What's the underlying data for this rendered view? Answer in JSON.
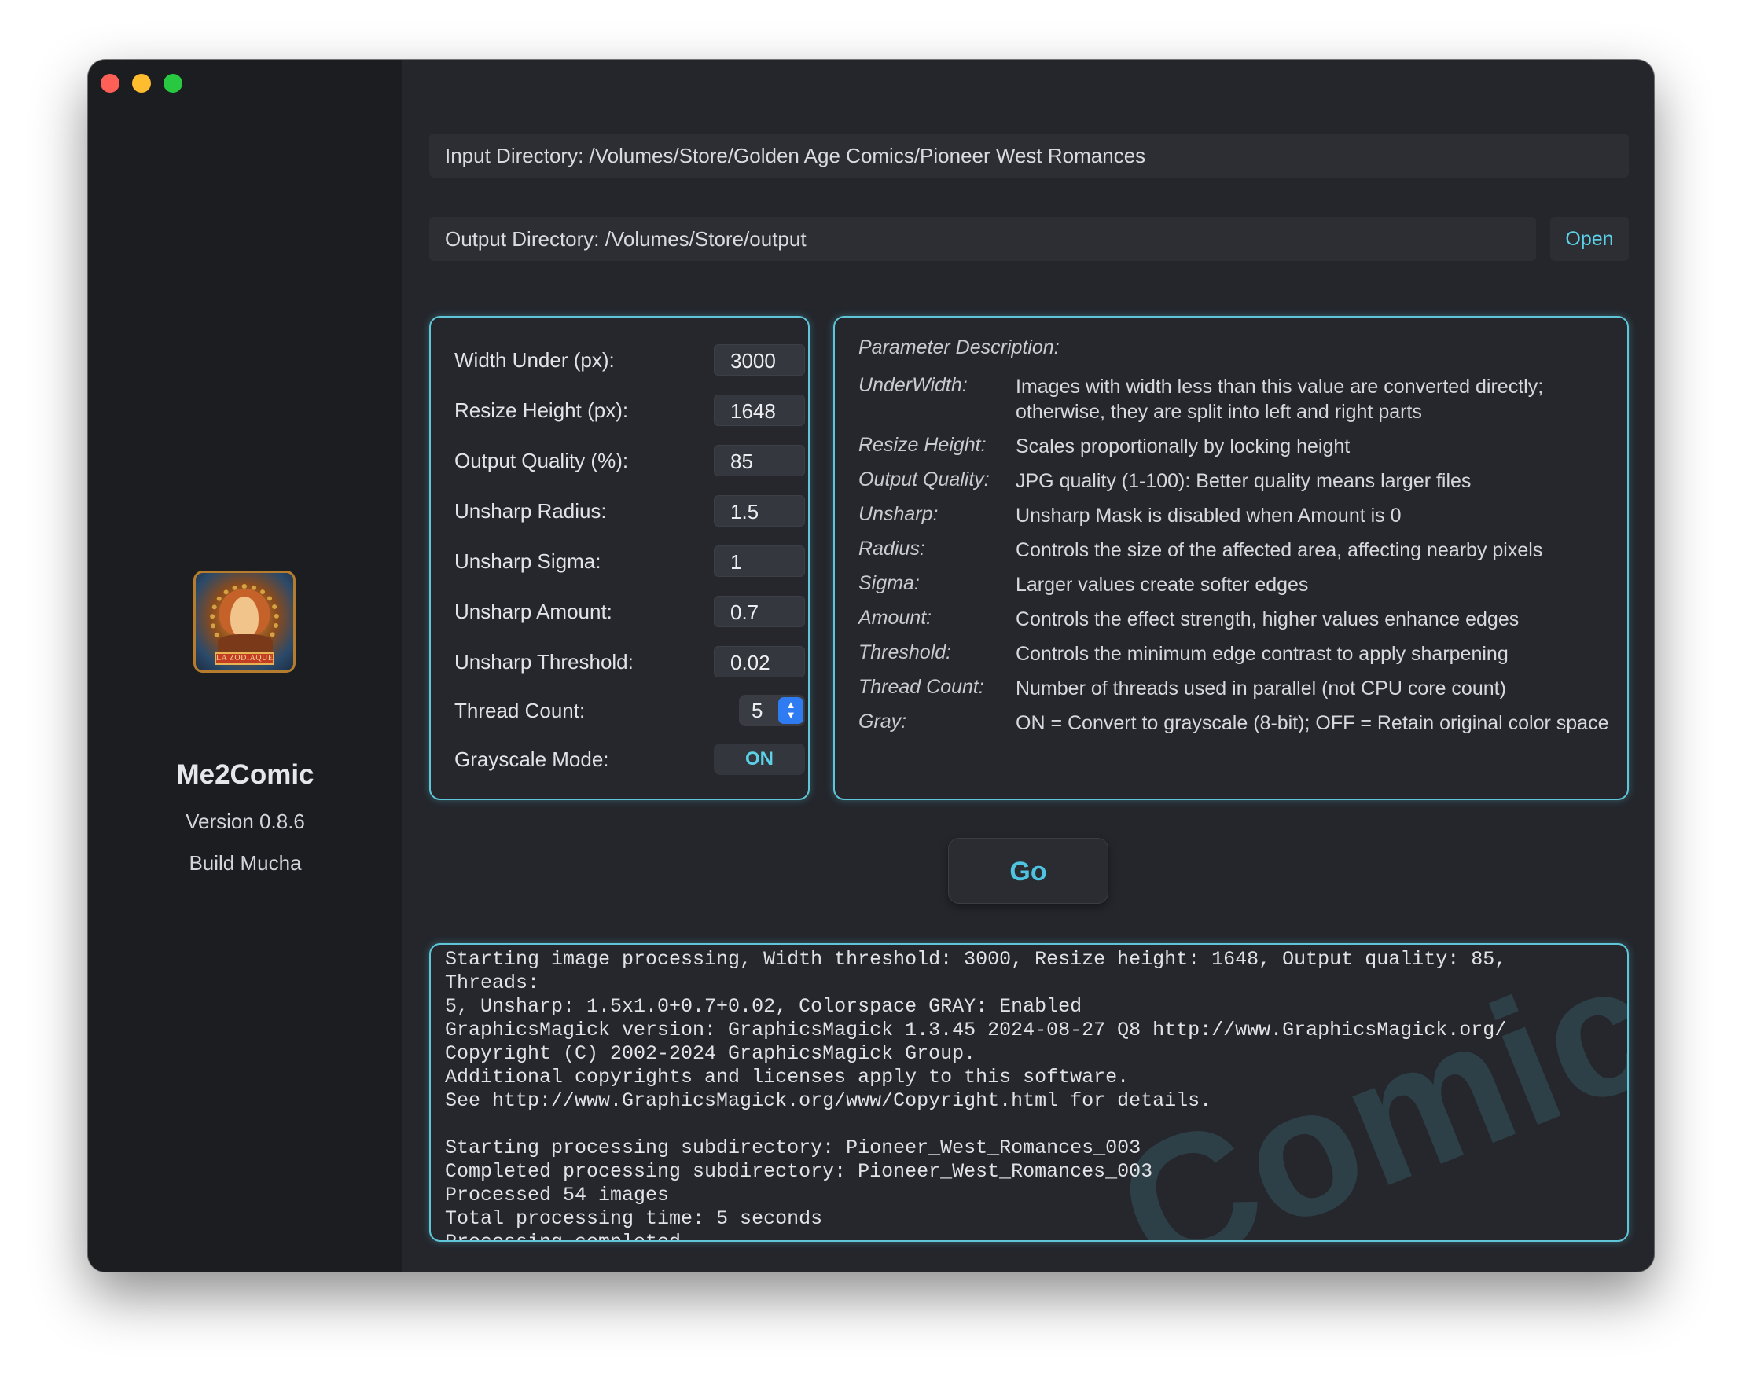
{
  "sidebar": {
    "logo_text": "LA ZODIAQUE",
    "app_name": "Me2Comic",
    "version": "Version 0.8.6",
    "build": "Build Mucha"
  },
  "directories": {
    "input": "Input Directory: /Volumes/Store/Golden Age Comics/Pioneer West Romances",
    "output": "Output Directory: /Volumes/Store/output",
    "open_label": "Open"
  },
  "params": [
    {
      "label": "Width Under (px):",
      "value": "3000"
    },
    {
      "label": "Resize Height (px):",
      "value": "1648"
    },
    {
      "label": "Output Quality (%):",
      "value": "85"
    },
    {
      "label": "Unsharp Radius:",
      "value": "1.5"
    },
    {
      "label": "Unsharp Sigma:",
      "value": "1"
    },
    {
      "label": "Unsharp Amount:",
      "value": "0.7"
    },
    {
      "label": "Unsharp Threshold:",
      "value": "0.02"
    }
  ],
  "thread": {
    "label": "Thread Count:",
    "value": "5"
  },
  "grayscale": {
    "label": "Grayscale Mode:",
    "value": "ON"
  },
  "description": {
    "title": "Parameter Description:",
    "items": [
      {
        "term": "UnderWidth:",
        "text": "Images with width less than this value are converted directly; otherwise, they are split into left and right parts"
      },
      {
        "term": "Resize Height:",
        "text": "Scales proportionally by locking height"
      },
      {
        "term": "Output Quality:",
        "text": "JPG quality (1-100): Better quality means larger files"
      },
      {
        "term": "Unsharp:",
        "text": "Unsharp Mask is disabled when Amount is 0"
      },
      {
        "term": "Radius:",
        "text": "Controls the size of the affected area, affecting nearby pixels"
      },
      {
        "term": "Sigma:",
        "text": "Larger values create softer edges"
      },
      {
        "term": "Amount:",
        "text": "Controls the effect strength, higher values enhance edges"
      },
      {
        "term": "Threshold:",
        "text": "Controls the minimum edge contrast to apply sharpening"
      },
      {
        "term": "Thread Count:",
        "text": "Number of threads used in parallel (not CPU core count)"
      },
      {
        "term": "Gray:",
        "text": "ON = Convert to grayscale (8-bit); OFF = Retain original color space"
      }
    ]
  },
  "go_label": "Go",
  "log": {
    "watermark": "Comic",
    "lines": [
      "Starting image processing, Width threshold: 3000, Resize height: 1648, Output quality: 85, Threads:",
      "5, Unsharp: 1.5x1.0+0.7+0.02, Colorspace GRAY: Enabled",
      "GraphicsMagick version: GraphicsMagick 1.3.45 2024-08-27 Q8 http://www.GraphicsMagick.org/",
      "Copyright (C) 2002-2024 GraphicsMagick Group.",
      "Additional copyrights and licenses apply to this software.",
      "See http://www.GraphicsMagick.org/www/Copyright.html for details.",
      "",
      "Starting processing subdirectory: Pioneer_West_Romances_003",
      "Completed processing subdirectory: Pioneer_West_Romances_003",
      "Processed 54 images",
      "Total processing time: 5 seconds",
      "Processing completed"
    ]
  },
  "colors": {
    "accent": "#5cd0e6",
    "window_bg": "#24262c",
    "sidebar_bg": "#1c1d21",
    "stepper": "#2f7bf2"
  }
}
